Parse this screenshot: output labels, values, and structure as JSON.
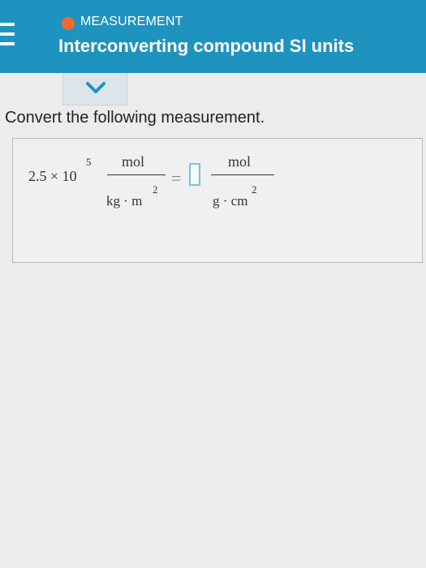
{
  "header": {
    "topic": "MEASUREMENT",
    "title": "Interconverting compound SI units",
    "accent": "#1f93c0",
    "status_color": "#f26b2d"
  },
  "question": {
    "prompt": "Convert the following measurement."
  },
  "equation": {
    "coefficient": "2.5 × 10",
    "exponent": "5",
    "left_numerator": "mol",
    "left_denominator": "kg · m",
    "left_denominator_exponent": "2",
    "equals": "=",
    "right_numerator": "mol",
    "right_denominator": "g · cm",
    "right_denominator_exponent": "2"
  }
}
